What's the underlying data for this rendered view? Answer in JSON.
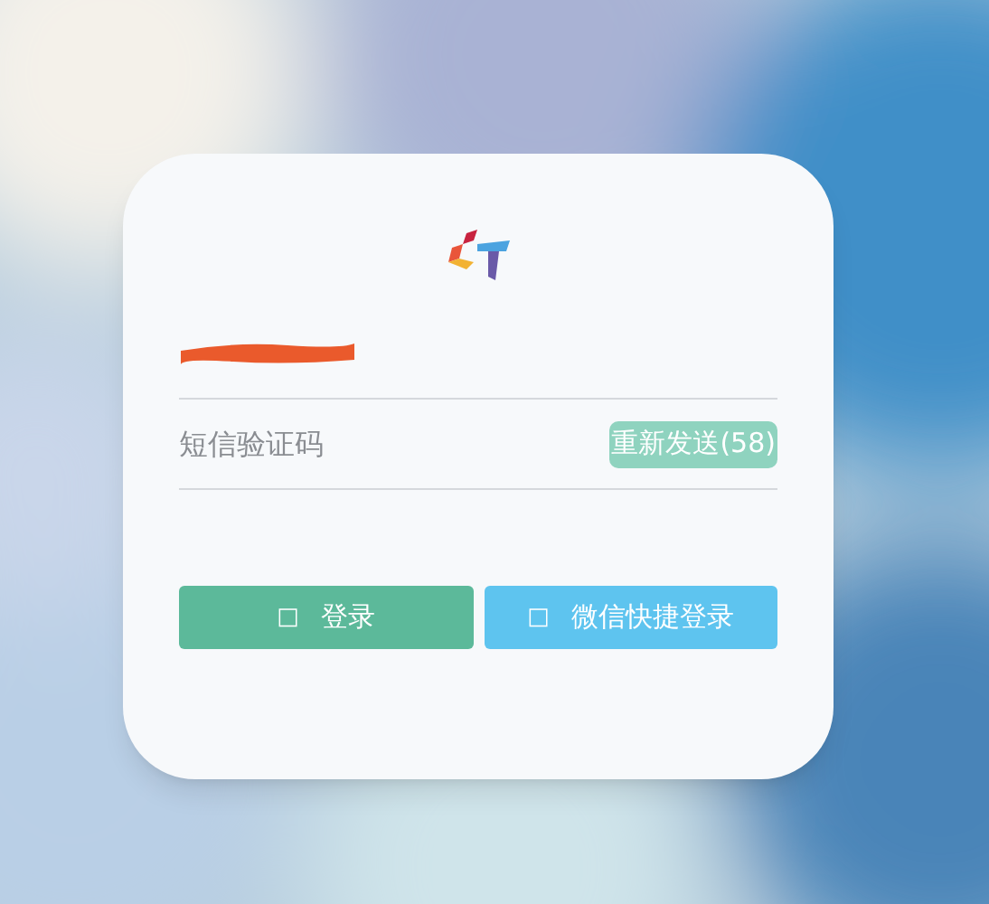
{
  "phone_field": {
    "redacted": true
  },
  "code_field": {
    "placeholder": "短信验证码",
    "resend_button": "重新发送(58)"
  },
  "buttons": [
    {
      "kind": "login",
      "icon": "□",
      "label": "登录"
    },
    {
      "kind": "wechat",
      "icon": "□",
      "label": "微信快捷登录"
    }
  ]
}
